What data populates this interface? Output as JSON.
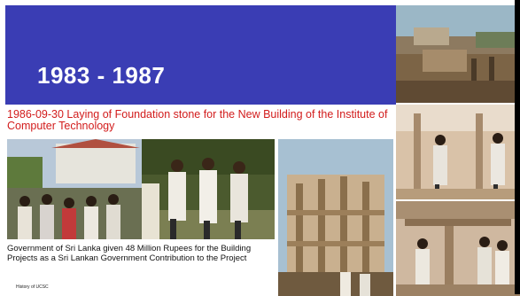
{
  "slide": {
    "title": "1983 - 1987",
    "caption": "1986-09-30 Laying of Foundation stone for the New Building of the Institute of Computer Technology",
    "note": "Government of Sri Lanka given 48 Million Rupees for the Building Projects as a Sri Lankan Government Contribution to the Project",
    "footer": "History of UCSC"
  },
  "colors": {
    "title_band": "#3a3db4",
    "caption_text": "#d21c1c"
  }
}
